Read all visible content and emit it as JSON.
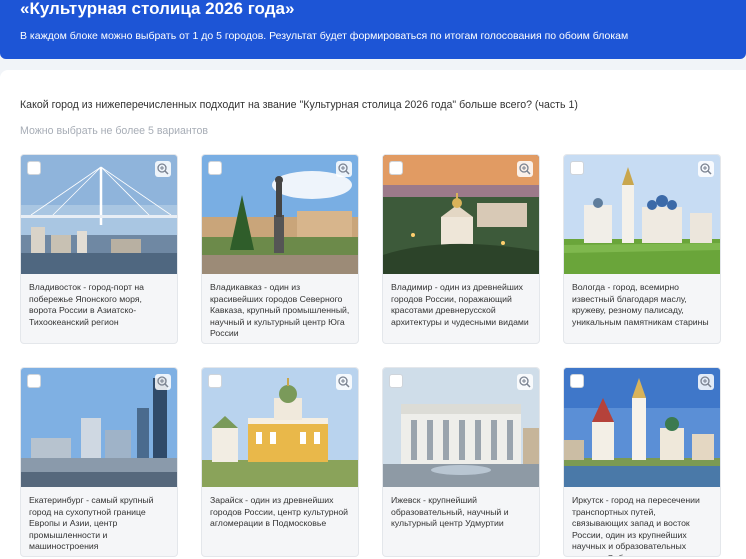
{
  "header": {
    "title": "«Культурная столица 2026 года»",
    "subtitle": "В каждом блоке можно выбрать от 1 до 5 городов. Результат будет формироваться по итогам голосования по обоим блокам"
  },
  "survey": {
    "question": "Какой город из нижеперечисленных подходит на звание \"Культурная столица 2026 года\" больше всего? (часть 1)",
    "hint": "Можно выбрать не более 5 вариантов"
  },
  "cities": [
    {
      "caption": "Владивосток - город-порт на побережье Японского моря, ворота России в Азиатско-Тихоокеанский регион",
      "icon": "bridge-photo",
      "selected": false
    },
    {
      "caption": "Владикавказ - один из красивейших городов Северного Кавказа, крупный промышленный, научный и культурный центр Юга России",
      "icon": "monument-photo",
      "selected": false
    },
    {
      "caption": "Владимир - один из древнейших городов России, поражающий красотами древнерусской архитектуры и чудесными видами",
      "icon": "cathedral-photo",
      "selected": false
    },
    {
      "caption": "Вологда - город, всемирно известный благодаря маслу, кружеву, резному палисаду, уникальным памятникам старины",
      "icon": "kremlin-photo",
      "selected": false
    },
    {
      "caption": "Екатеринбург - самый крупный город на сухопутной границе Европы и Азии, центр промышленности и машиностроения",
      "icon": "skyline-photo",
      "selected": false
    },
    {
      "caption": "Зарайск - один из древнейших городов России, центр культурной агломерации в Подмосковье",
      "icon": "church-photo",
      "selected": false
    },
    {
      "caption": "Ижевск - крупнейший образовательный, научный и культурный центр Удмуртии",
      "icon": "theater-photo",
      "selected": false
    },
    {
      "caption": "Иркутск - город на пересечении транспортных путей, связывающих запад и восток России, один из крупнейших научных и образовательных центров Сибири",
      "icon": "river-church-photo",
      "selected": false
    }
  ]
}
